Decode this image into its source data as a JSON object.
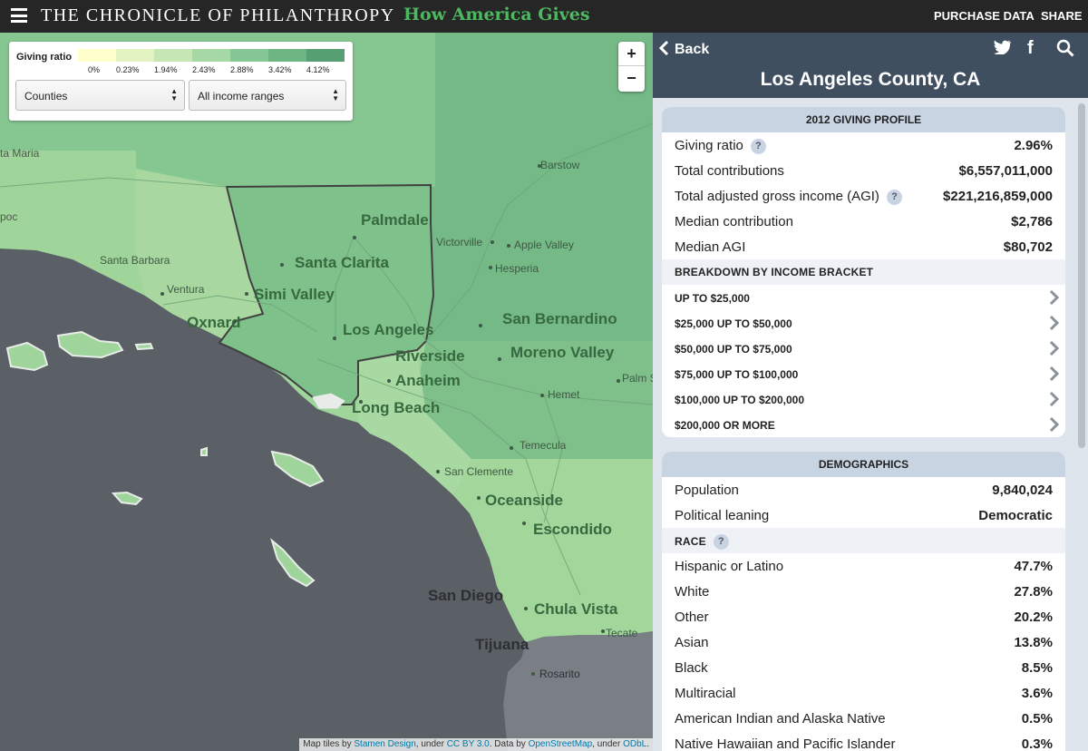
{
  "header": {
    "brand": "THE CHRONICLE OF PHILANTHROPY",
    "subbrand": "How America Gives",
    "purchase_label": "PURCHASE DATA",
    "share_label": "SHARE"
  },
  "map": {
    "legend": {
      "title": "Giving ratio",
      "colors": [
        "#ffffcc",
        "#e2f2c0",
        "#c6e6b4",
        "#a6d9a5",
        "#86c796",
        "#6db583",
        "#559f72"
      ],
      "ticks": [
        "0%",
        "0.23%",
        "1.94%",
        "2.43%",
        "2.88%",
        "3.42%",
        "4.12%"
      ]
    },
    "geography_select": "Counties",
    "income_select": "All income ranges",
    "zoom_in": "+",
    "zoom_out": "−",
    "cities": {
      "santa_maria": "ta Maria",
      "barstow": "Barstow",
      "palmdale": "Palmdale",
      "victorville": "Victorville",
      "apple_valley": "Apple Valley",
      "hesperia": "Hesperia",
      "santa_barbara": "Santa Barbara",
      "santa_clarita": "Santa Clarita",
      "ventura": "Ventura",
      "simi_valley": "Simi Valley",
      "oxnard": "Oxnard",
      "san_bernardino": "San Bernardino",
      "los_angeles": "Los Angeles",
      "riverside": "Riverside",
      "moreno_valley": "Moreno Valley",
      "anaheim": "Anaheim",
      "palm_s": "Palm S",
      "hemet": "Hemet",
      "long_beach": "Long Beach",
      "temecula": "Temecula",
      "san_clemente": "San Clemente",
      "oceanside": "Oceanside",
      "escondido": "Escondido",
      "san_diego": "San Diego",
      "chula_vista": "Chula Vista",
      "tecate": "Tecate",
      "tijuana": "Tijuana",
      "rosarito": "Rosarito",
      "poc": "poc"
    },
    "attribution": {
      "prefix": "Map tiles by ",
      "stamen": "Stamen Design",
      "under1": ", under ",
      "ccby": "CC BY 3.0",
      "data_by": ". Data by ",
      "osm": "OpenStreetMap",
      "under2": ", under ",
      "odbl": "ODbL",
      "end": "."
    }
  },
  "panel": {
    "back_label": "Back",
    "county_title": "Los Angeles County, CA",
    "giving_profile": {
      "title": "2012 GIVING PROFILE",
      "giving_ratio": {
        "label": "Giving ratio",
        "value": "2.96%"
      },
      "total_contributions": {
        "label": "Total contributions",
        "value": "$6,557,011,000"
      },
      "total_agi": {
        "label": "Total adjusted gross income (AGI)",
        "value": "$221,216,859,000"
      },
      "median_contribution": {
        "label": "Median contribution",
        "value": "$2,786"
      },
      "median_agi": {
        "label": "Median AGI",
        "value": "$80,702"
      },
      "breakdown_title": "BREAKDOWN BY INCOME BRACKET",
      "brackets": [
        "UP TO $25,000",
        "$25,000 UP TO $50,000",
        "$50,000 UP TO $75,000",
        "$75,000 UP TO $100,000",
        "$100,000 UP TO $200,000",
        "$200,000 OR MORE"
      ]
    },
    "demographics": {
      "title": "DEMOGRAPHICS",
      "population": {
        "label": "Population",
        "value": "9,840,024"
      },
      "political": {
        "label": "Political leaning",
        "value": "Democratic"
      },
      "race_title": "RACE",
      "race": [
        {
          "label": "Hispanic or Latino",
          "value": "47.7%"
        },
        {
          "label": "White",
          "value": "27.8%"
        },
        {
          "label": "Other",
          "value": "20.2%"
        },
        {
          "label": "Asian",
          "value": "13.8%"
        },
        {
          "label": "Black",
          "value": "8.5%"
        },
        {
          "label": "Multiracial",
          "value": "3.6%"
        },
        {
          "label": "American Indian and Alaska Native",
          "value": "0.5%"
        },
        {
          "label": "Native Hawaiian and Pacific Islander",
          "value": "0.3%"
        }
      ]
    },
    "help_glyph": "?"
  }
}
